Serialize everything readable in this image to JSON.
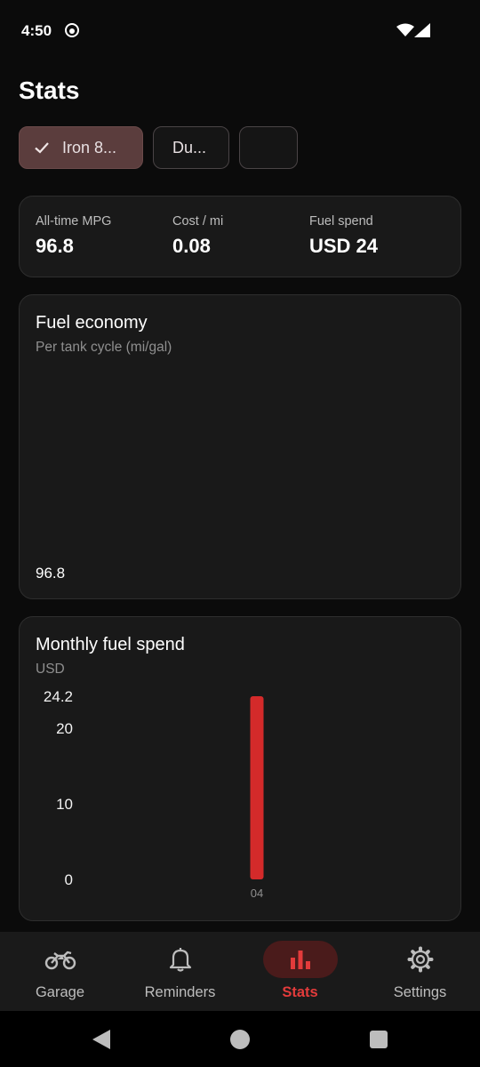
{
  "status_bar": {
    "time": "4:50"
  },
  "header": {
    "title": "Stats"
  },
  "vehicle_chips": [
    {
      "label": "Iron 8...",
      "selected": true
    },
    {
      "label": "Du...",
      "selected": false
    },
    {
      "label": "",
      "selected": false
    }
  ],
  "summary": {
    "all_time_mpg_label": "All-time MPG",
    "all_time_mpg_value": "96.8",
    "cost_per_mi_label": "Cost / mi",
    "cost_per_mi_value": "0.08",
    "fuel_spend_label": "Fuel spend",
    "fuel_spend_value": "USD 24"
  },
  "fuel_economy_card": {
    "title": "Fuel economy",
    "subtitle": "Per tank cycle (mi/gal)",
    "value_label": "96.8"
  },
  "monthly_card": {
    "title": "Monthly fuel spend",
    "subtitle": "USD"
  },
  "chart_data": {
    "type": "bar",
    "categories": [
      "04"
    ],
    "values": [
      24.2
    ],
    "ylim": [
      0,
      24.2
    ],
    "yticks": [
      "24.2",
      "20",
      "10",
      "0"
    ],
    "ytick_values": [
      24.2,
      20,
      10,
      0
    ],
    "title": "Monthly fuel spend",
    "ylabel": "USD",
    "bar_color": "#d42a2a",
    "grid": false
  },
  "bottom_nav": {
    "items": [
      {
        "label": "Garage",
        "icon": "motorcycle-icon",
        "active": false
      },
      {
        "label": "Reminders",
        "icon": "bell-icon",
        "active": false
      },
      {
        "label": "Stats",
        "icon": "bar-chart-icon",
        "active": true
      },
      {
        "label": "Settings",
        "icon": "gear-icon",
        "active": false
      }
    ]
  },
  "colors": {
    "accent": "#e33b3b",
    "active_pill": "#4a1b1b",
    "selected_chip": "#5b3d3d",
    "card_bg": "#191919",
    "page_bg": "#0b0b0b"
  }
}
